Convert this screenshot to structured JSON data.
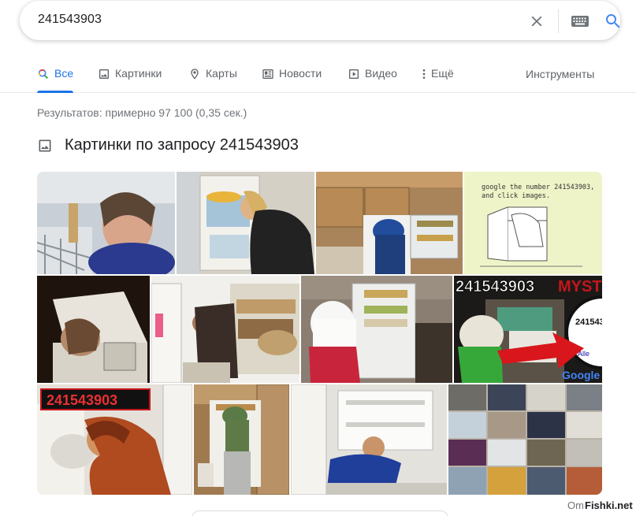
{
  "search": {
    "query": "241543903"
  },
  "tabs": [
    {
      "label": "Все",
      "icon": "search-icon"
    },
    {
      "label": "Картинки",
      "icon": "image-icon"
    },
    {
      "label": "Карты",
      "icon": "map-pin-icon"
    },
    {
      "label": "Новости",
      "icon": "news-icon"
    },
    {
      "label": "Видео",
      "icon": "play-icon"
    },
    {
      "label": "Ещё",
      "icon": "more-vert-icon"
    }
  ],
  "tools_label": "Инструменты",
  "stats": "Результатов: примерно 97 100 (0,35 сек.)",
  "images_section": {
    "title": "Картинки по запросу 241543903",
    "thumb_text": {
      "google_note": "google the number 241543903,",
      "google_note_2": "and click images.",
      "myst_number": "241543903",
      "myst_word": "MYST",
      "zoom_number": "241543",
      "alle": "Alle",
      "google": "Google",
      "red_number": "241543903"
    }
  },
  "footer": {
    "omit_partial": "Om",
    "watermark": "Fishki.net"
  },
  "colors": {
    "accent": "#1a73e8",
    "text_secondary": "#70757a"
  }
}
